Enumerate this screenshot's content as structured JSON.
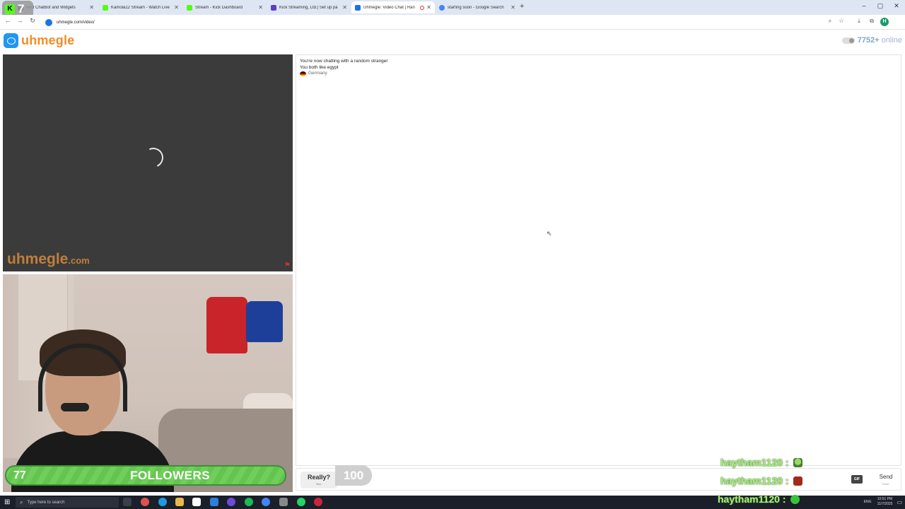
{
  "overlay": {
    "top_left_number": "7",
    "badge_letter": "K"
  },
  "browser": {
    "tabs": [
      {
        "label": "best ChatBot and Widgets",
        "color": "#444444"
      },
      {
        "label": "Kamola12 Stream - Watch Live",
        "color": "#53fc18"
      },
      {
        "label": "Stream - Kick Dashboard",
        "color": "#53fc18"
      },
      {
        "label": "Kick Streaming, Ltd.| Set up pa",
        "color": "#5b3fc4"
      },
      {
        "label": "Uhmegle: Video Chat | Ran",
        "color": "#1a73e8"
      },
      {
        "label": "starting soon - Google Search",
        "color": "#4285f4"
      }
    ],
    "new_tab": "+",
    "url": "uhmegle.com/video/",
    "profile_initial": "H",
    "window_controls": [
      "–",
      "▢",
      "✕"
    ]
  },
  "site": {
    "logo_text": "uhmegle",
    "online_count": "7752+",
    "online_label": "online"
  },
  "video": {
    "watermark_main": "uhmegle",
    "watermark_suffix": ".com"
  },
  "chat": {
    "line1": "You're now chatting with a random stranger",
    "line2": "You both like egypt",
    "country": "Germany"
  },
  "controls": {
    "really_label": "Really?",
    "really_hint": "Esc",
    "gif_label": "GIF",
    "send_label": "Send",
    "send_hint": "Enter"
  },
  "stream_overlay": {
    "followers_current": "77",
    "followers_label": "FOLLOWERS",
    "followers_goal": "100",
    "chat_messages": [
      {
        "user": "haytham1120",
        "sep": ":",
        "emote": "alien"
      },
      {
        "user": "haytham1120",
        "sep": ":",
        "emote": "red"
      },
      {
        "user": "haytham1120",
        "sep": ":",
        "emote": "green"
      }
    ]
  },
  "taskbar": {
    "search_placeholder": "Type here to search",
    "language": "ENG",
    "time": "10:51 PM",
    "date": "11/7/2025"
  },
  "colors": {
    "brand_orange": "#f28c28",
    "brand_blue": "#2196f3",
    "follower_green": "#6fcf5a",
    "chat_green": "#a8f07e"
  }
}
